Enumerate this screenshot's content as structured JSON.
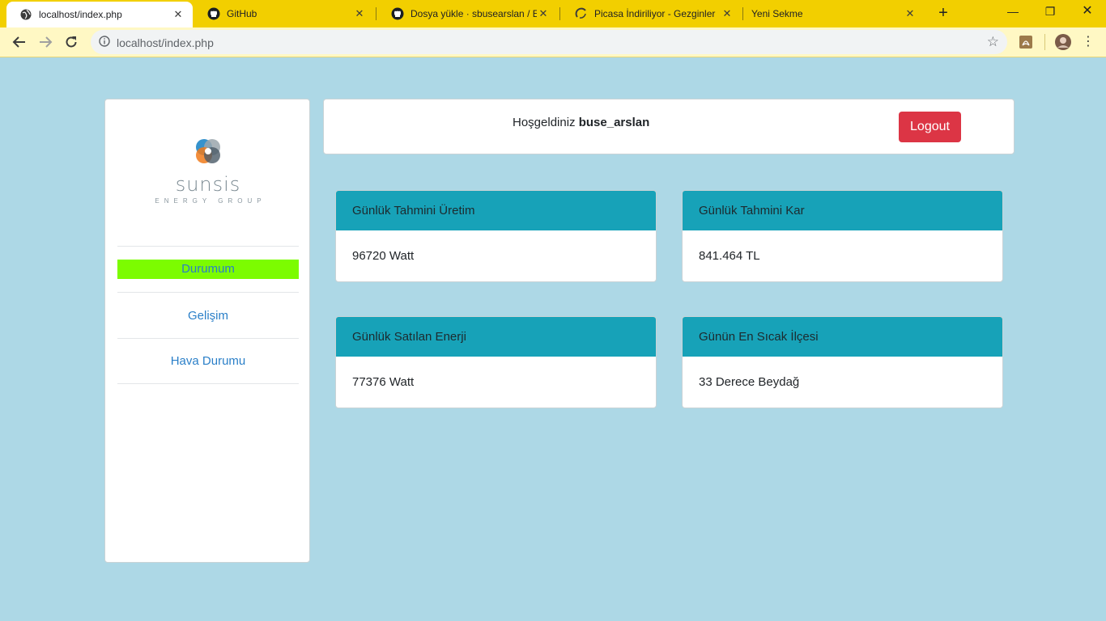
{
  "browser": {
    "tabs": [
      {
        "title": "localhost/index.php",
        "icon": "globe-icon"
      },
      {
        "title": "GitHub",
        "icon": "github-icon"
      },
      {
        "title": "Dosya yükle · sbusearslan / En",
        "icon": "github-icon"
      },
      {
        "title": "Picasa İndiriliyor - Gezginler",
        "icon": "loading-icon"
      },
      {
        "title": "Yeni Sekme",
        "icon": ""
      }
    ],
    "url": "localhost/index.php"
  },
  "sidebar": {
    "logo_word": "sunsis",
    "logo_sub": "ENERGY GROUP",
    "items": [
      {
        "label": "Durumum"
      },
      {
        "label": "Gelişim"
      },
      {
        "label": "Hava Durumu"
      }
    ],
    "active_color": "#7cfc00"
  },
  "header": {
    "welcome_prefix": "Hoşgeldiniz",
    "username": "buse_arslan",
    "logout_label": "Logout"
  },
  "cards": [
    {
      "title": "Günlük Tahmini Üretim",
      "value": "96720 Watt"
    },
    {
      "title": "Günlük Tahmini Kar",
      "value": "841.464 TL"
    },
    {
      "title": "Günlük Satılan Enerji",
      "value": "77376 Watt"
    },
    {
      "title": "Günün En Sıcak İlçesi",
      "value": "33 Derece Beydağ"
    }
  ],
  "colors": {
    "background": "#add8e6",
    "card_header": "#17a2b8",
    "logout": "#dc3545",
    "link": "#2a7fc8"
  }
}
